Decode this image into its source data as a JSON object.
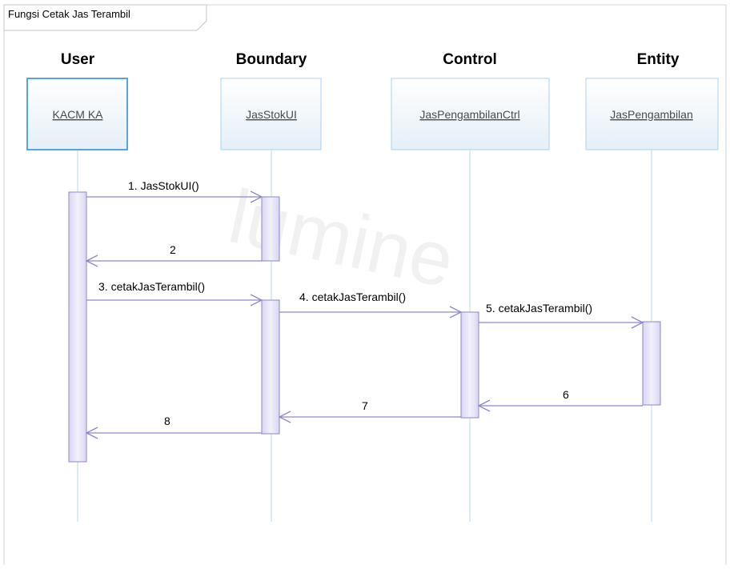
{
  "frame": {
    "title": "Fungsi Cetak Jas Terambil"
  },
  "lanes": [
    {
      "id": "user",
      "header": "User",
      "object": "KACM KA"
    },
    {
      "id": "boundary",
      "header": "Boundary",
      "object": "JasStokUI"
    },
    {
      "id": "control",
      "header": "Control",
      "object": "JasPengambilanCtrl"
    },
    {
      "id": "entity",
      "header": "Entity",
      "object": "JasPengambilan"
    }
  ],
  "messages": [
    {
      "label": "1. JasStokUI()",
      "from": "user",
      "to": "boundary",
      "kind": "call"
    },
    {
      "label": "2",
      "from": "boundary",
      "to": "user",
      "kind": "return"
    },
    {
      "label": "3. cetakJasTerambil()",
      "from": "user",
      "to": "boundary",
      "kind": "call"
    },
    {
      "label": "4. cetakJasTerambil()",
      "from": "boundary",
      "to": "control",
      "kind": "call"
    },
    {
      "label": "5. cetakJasTerambil()",
      "from": "control",
      "to": "entity",
      "kind": "call"
    },
    {
      "label": "6",
      "from": "entity",
      "to": "control",
      "kind": "return"
    },
    {
      "label": "7",
      "from": "control",
      "to": "boundary",
      "kind": "return"
    },
    {
      "label": "8",
      "from": "boundary",
      "to": "user",
      "kind": "return"
    }
  ],
  "colors": {
    "line": "#8c86cc",
    "lifeline": "#b8d8ea",
    "activation_fill": "#e6e4f6",
    "activation_stroke": "#8c86cc",
    "user_box_stroke": "#4ca0e0",
    "box_fill": "#eaf3f9",
    "box_stroke": "#9ccbec",
    "frame": "#c8c8d8"
  },
  "watermark": "lumine"
}
